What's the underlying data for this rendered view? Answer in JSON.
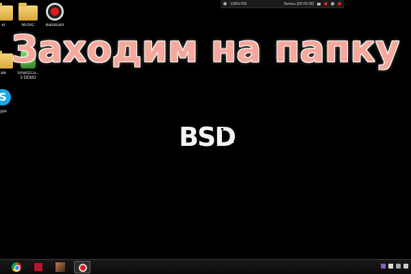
{
  "desktop": {
    "icons": [
      {
        "id": "folder-partial",
        "label": "er"
      },
      {
        "id": "music",
        "label": "MUSIC"
      },
      {
        "id": "bandicam",
        "label": "Bandicam"
      },
      {
        "id": "partial-2",
        "label": "ale"
      },
      {
        "id": "smart",
        "label": "Smart2Cu...\n3 DEMO"
      },
      {
        "id": "skype",
        "label": "ype"
      }
    ]
  },
  "recorder_bar": {
    "resolution": "1366x768",
    "status": "Запись [00:00:38]"
  },
  "overlay": {
    "title": "Заходим на папку",
    "logo_text": "BSD"
  },
  "colors": {
    "title": "#f5a99c",
    "background": "#000000",
    "record_red": "#e21a1a"
  },
  "taskbar": {
    "apps": [
      "chrome-icon",
      "red-app-icon",
      "photo-app-icon",
      "bandicam-icon"
    ]
  }
}
